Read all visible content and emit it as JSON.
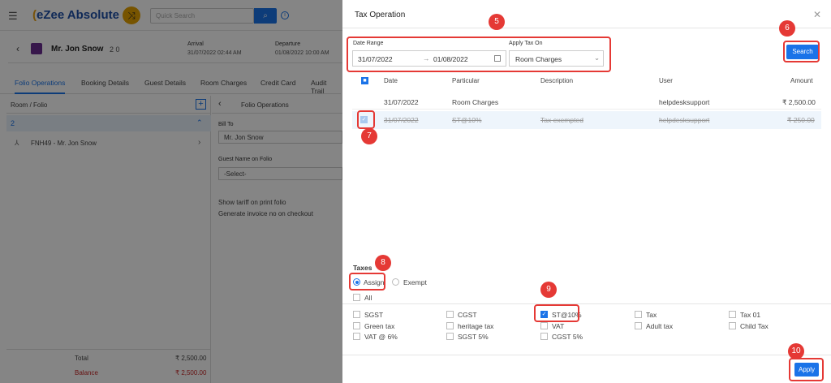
{
  "app": {
    "logo": "eZee Absolute",
    "search_placeholder": "Quick Search"
  },
  "guest": {
    "name": "Mr. Jon Snow",
    "counts": "2   0",
    "arrival_label": "Arrival",
    "arrival": "31/07/2022 02:44 AM",
    "departure_label": "Departure",
    "departure": "01/08/2022 10:00 AM"
  },
  "tabs": [
    "Folio Operations",
    "Booking Details",
    "Guest Details",
    "Room Charges",
    "Credit Card",
    "Audit Trail"
  ],
  "left": {
    "header": "Room / Folio",
    "room": "2",
    "folio": "FNH49 - Mr. Jon Snow",
    "total_label": "Total",
    "total": "₹ 2,500.00",
    "balance_label": "Balance",
    "balance": "₹ 2,500.00"
  },
  "mid": {
    "title": "Folio Operations",
    "bill_to_label": "Bill To",
    "bill_to": "Mr. Jon Snow",
    "guest_name_label": "Guest Name on Folio",
    "guest_name": "-Select-",
    "opt1": "Show tariff on print folio",
    "opt2": "Generate invoice no on checkout"
  },
  "modal": {
    "title": "Tax Operation",
    "date_range_label": "Date Range",
    "date_from": "31/07/2022",
    "date_to": "01/08/2022",
    "apply_tax_label": "Apply Tax On",
    "apply_tax": "Room Charges",
    "search": "Search",
    "columns": {
      "date": "Date",
      "particular": "Particular",
      "description": "Description",
      "user": "User",
      "amount": "Amount"
    },
    "rows": [
      {
        "date": "31/07/2022",
        "particular": "Room Charges",
        "description": "",
        "user": "helpdesksupport",
        "amount": "₹ 2,500.00"
      },
      {
        "date": "31/07/2022",
        "particular": "ST@10%",
        "description": "Tax exempted",
        "user": "helpdesksupport",
        "amount": "₹ 250.00"
      }
    ],
    "taxes_label": "Taxes",
    "assign": "Assign",
    "exempt": "Exempt",
    "all": "All",
    "tax_items": [
      "SGST",
      "CGST",
      "ST@10%",
      "Tax",
      "Tax 01",
      "Green tax",
      "heritage tax",
      "VAT",
      "Adult tax",
      "Child Tax",
      "VAT @ 6%",
      "SGST 5%",
      "CGST 5%"
    ],
    "apply": "Apply"
  },
  "markers": [
    "5",
    "6",
    "7",
    "8",
    "9",
    "10"
  ],
  "colors": {
    "accent": "#1a73e8",
    "marker": "#e53935"
  }
}
